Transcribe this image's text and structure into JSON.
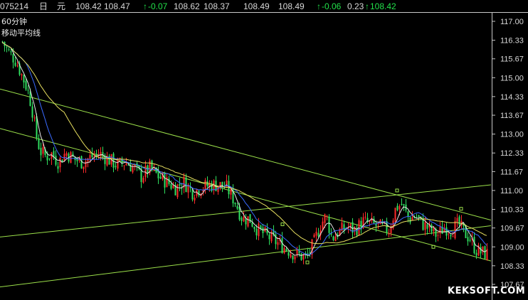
{
  "header": {
    "code": "075214",
    "period_char": "日",
    "unit_char": "元",
    "open": "108.42",
    "high": "108.47",
    "change_arrow": "↑",
    "change": "-0.07",
    "v1": "108.62",
    "v2": "108.37",
    "v3": "108.49",
    "v4": "108.49",
    "change2_arrow": "↑",
    "change2": "-0.06",
    "pct": "0.23",
    "last_arrow": "↑",
    "last": "108.42"
  },
  "chart_labels": {
    "interval": "60分钟",
    "indicator": "移动平均线"
  },
  "watermark": "KEKSOFT.COM",
  "colors": {
    "background": "#000000",
    "up_candle": "#ff2a2a",
    "down_candle": "#30e060",
    "ma_short": "#e6e6e6",
    "ma_mid": "#3a6bff",
    "ma_long": "#e8e060",
    "trendline": "#9be04a",
    "axis": "#c8c8c8"
  },
  "chart_data": {
    "type": "candlestick",
    "title": "",
    "y_axis": {
      "ticks": [
        "117.00",
        "116.33",
        "115.67",
        "115.00",
        "114.33",
        "113.67",
        "113.00",
        "112.33",
        "111.67",
        "111.00",
        "110.33",
        "109.67",
        "109.00",
        "108.33",
        "107.67"
      ],
      "range": [
        107.67,
        117.0
      ]
    },
    "price_path": [
      [
        0,
        116.4
      ],
      [
        12,
        115.9
      ],
      [
        22,
        115.6
      ],
      [
        30,
        115.1
      ],
      [
        38,
        114.6
      ],
      [
        44,
        114.0
      ],
      [
        50,
        113.0
      ],
      [
        56,
        112.4
      ],
      [
        64,
        112.2
      ],
      [
        72,
        112.3
      ],
      [
        82,
        112.0
      ],
      [
        92,
        112.35
      ],
      [
        104,
        112.1
      ],
      [
        116,
        112.0
      ],
      [
        128,
        112.2
      ],
      [
        140,
        112.3
      ],
      [
        152,
        112.1
      ],
      [
        164,
        111.9
      ],
      [
        176,
        112.0
      ],
      [
        188,
        111.8
      ],
      [
        198,
        111.5
      ],
      [
        210,
        111.8
      ],
      [
        222,
        111.5
      ],
      [
        234,
        111.3
      ],
      [
        246,
        111.1
      ],
      [
        258,
        111.3
      ],
      [
        270,
        110.95
      ],
      [
        282,
        111.1
      ],
      [
        294,
        111.2
      ],
      [
        306,
        111.2
      ],
      [
        318,
        111.1
      ],
      [
        330,
        110.6
      ],
      [
        340,
        110.0
      ],
      [
        350,
        110.0
      ],
      [
        362,
        109.6
      ],
      [
        374,
        109.4
      ],
      [
        386,
        109.2
      ],
      [
        398,
        109.0
      ],
      [
        410,
        108.8
      ],
      [
        420,
        108.7
      ],
      [
        430,
        108.6
      ],
      [
        440,
        109.1
      ],
      [
        450,
        109.8
      ],
      [
        458,
        110.1
      ],
      [
        466,
        109.3
      ],
      [
        474,
        109.5
      ],
      [
        486,
        109.7
      ],
      [
        498,
        109.6
      ],
      [
        510,
        109.9
      ],
      [
        522,
        109.8
      ],
      [
        534,
        109.7
      ],
      [
        546,
        109.6
      ],
      [
        556,
        110.4
      ],
      [
        564,
        110.5
      ],
      [
        574,
        110.0
      ],
      [
        584,
        110.1
      ],
      [
        594,
        109.8
      ],
      [
        604,
        109.6
      ],
      [
        614,
        109.4
      ],
      [
        624,
        109.7
      ],
      [
        634,
        109.6
      ],
      [
        644,
        109.8
      ],
      [
        652,
        109.5
      ],
      [
        660,
        109.3
      ],
      [
        668,
        108.9
      ],
      [
        676,
        108.8
      ],
      [
        684,
        108.75
      ]
    ],
    "moving_averages": [
      {
        "name": "",
        "period": 5,
        "color": "#e6e6e6"
      },
      {
        "name": "",
        "period": 12,
        "color": "#3a6bff"
      },
      {
        "name": "",
        "period": 30,
        "color": "#e8e060"
      }
    ],
    "trendlines": [
      {
        "from": [
          0,
          114.6
        ],
        "to": [
          690,
          109.95
        ]
      },
      {
        "from": [
          0,
          113.2
        ],
        "to": [
          690,
          108.5
        ]
      },
      {
        "from": [
          0,
          109.35
        ],
        "to": [
          690,
          111.2
        ]
      },
      {
        "from": [
          0,
          107.58
        ],
        "to": [
          690,
          109.75
        ]
      }
    ]
  }
}
